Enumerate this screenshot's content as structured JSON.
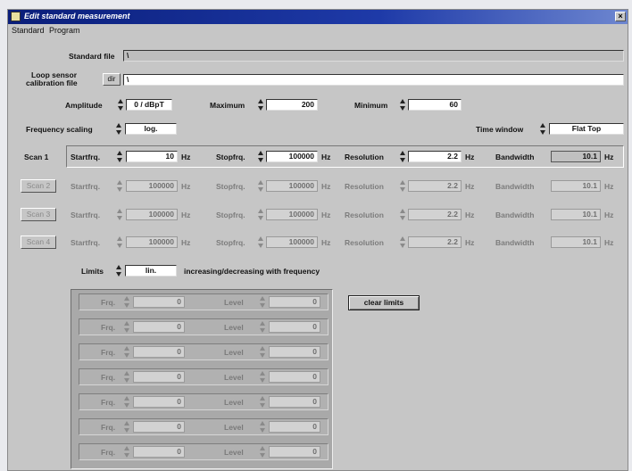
{
  "window": {
    "title": "Edit standard measurement",
    "close_glyph": "×"
  },
  "menu": [
    "Standard",
    "Program"
  ],
  "standard_file": {
    "label": "Standard file",
    "value": "\\"
  },
  "loop_sensor": {
    "label_line1": "Loop sensor",
    "label_line2": "calibration file",
    "browse_label": "dir",
    "value": "\\"
  },
  "amplitude": {
    "label": "Amplitude",
    "value": "0 / dBpT"
  },
  "maximum": {
    "label": "Maximum",
    "value": "200"
  },
  "minimum": {
    "label": "Minimum",
    "value": "60"
  },
  "frequency_scaling": {
    "label": "Frequency scaling",
    "value": "log."
  },
  "time_window": {
    "label": "Time window",
    "value": "Flat Top"
  },
  "scan_labels": {
    "start": "Startfrq.",
    "stop": "Stopfrq.",
    "resolution": "Resolution",
    "bandwidth": "Bandwidth",
    "hz": "Hz"
  },
  "scans": [
    {
      "name": "Scan 1",
      "start": "10",
      "stop": "100000",
      "resolution": "2.2",
      "bandwidth": "10.1",
      "enabled": true
    },
    {
      "name": "Scan 2",
      "start": "100000",
      "stop": "100000",
      "resolution": "2.2",
      "bandwidth": "10.1",
      "enabled": false
    },
    {
      "name": "Scan 3",
      "start": "100000",
      "stop": "100000",
      "resolution": "2.2",
      "bandwidth": "10.1",
      "enabled": false
    },
    {
      "name": "Scan 4",
      "start": "100000",
      "stop": "100000",
      "resolution": "2.2",
      "bandwidth": "10.1",
      "enabled": false
    }
  ],
  "limits": {
    "label": "Limits",
    "value": "lin.",
    "description": "increasing/decreasing with frequency",
    "clear_button": "clear limits"
  },
  "limit_labels": {
    "freq": "Frq.",
    "level": "Level"
  },
  "limit_rows": [
    {
      "freq": "0",
      "level": "0"
    },
    {
      "freq": "0",
      "level": "0"
    },
    {
      "freq": "0",
      "level": "0"
    },
    {
      "freq": "0",
      "level": "0"
    },
    {
      "freq": "0",
      "level": "0"
    },
    {
      "freq": "0",
      "level": "0"
    },
    {
      "freq": "0",
      "level": "0"
    }
  ],
  "icons": {
    "spinner": "updown-spinner-icon",
    "app": "app-icon",
    "close": "close-icon"
  }
}
